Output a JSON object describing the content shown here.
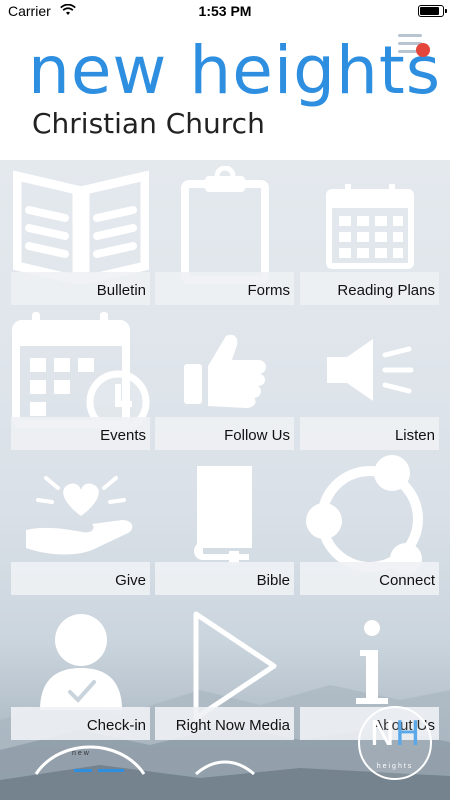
{
  "status_bar": {
    "carrier": "Carrier",
    "time": "1:53 PM",
    "battery_level": 0.85
  },
  "header": {
    "title": "new heights",
    "subtitle": "Christian Church",
    "menu_icon": "hamburger-menu-icon",
    "notification_dot_color": "#e5463b"
  },
  "colors": {
    "brand_blue": "#2e8fe0",
    "tile_label_bg": "#eef1f4"
  },
  "tiles": [
    {
      "label": "Bulletin",
      "icon": "open-book-icon"
    },
    {
      "label": "Forms",
      "icon": "clipboard-icon"
    },
    {
      "label": "Reading Plans",
      "icon": "calendar-icon"
    },
    {
      "label": "Events",
      "icon": "calendar-clock-icon"
    },
    {
      "label": "Follow Us",
      "icon": "thumbs-up-icon"
    },
    {
      "label": "Listen",
      "icon": "speaker-icon"
    },
    {
      "label": "Give",
      "icon": "heart-hand-icon"
    },
    {
      "label": "Bible",
      "icon": "bible-icon"
    },
    {
      "label": "Connect",
      "icon": "share-icon"
    },
    {
      "label": "Check-in",
      "icon": "user-check-icon"
    },
    {
      "label": "Right Now Media",
      "icon": "play-icon"
    },
    {
      "label": "About Us",
      "icon": "info-icon"
    }
  ],
  "footer": {
    "nav_small_label": "new",
    "logo_letters": "N",
    "logo_letters_accent": "H",
    "logo_subtitle": "heights"
  }
}
